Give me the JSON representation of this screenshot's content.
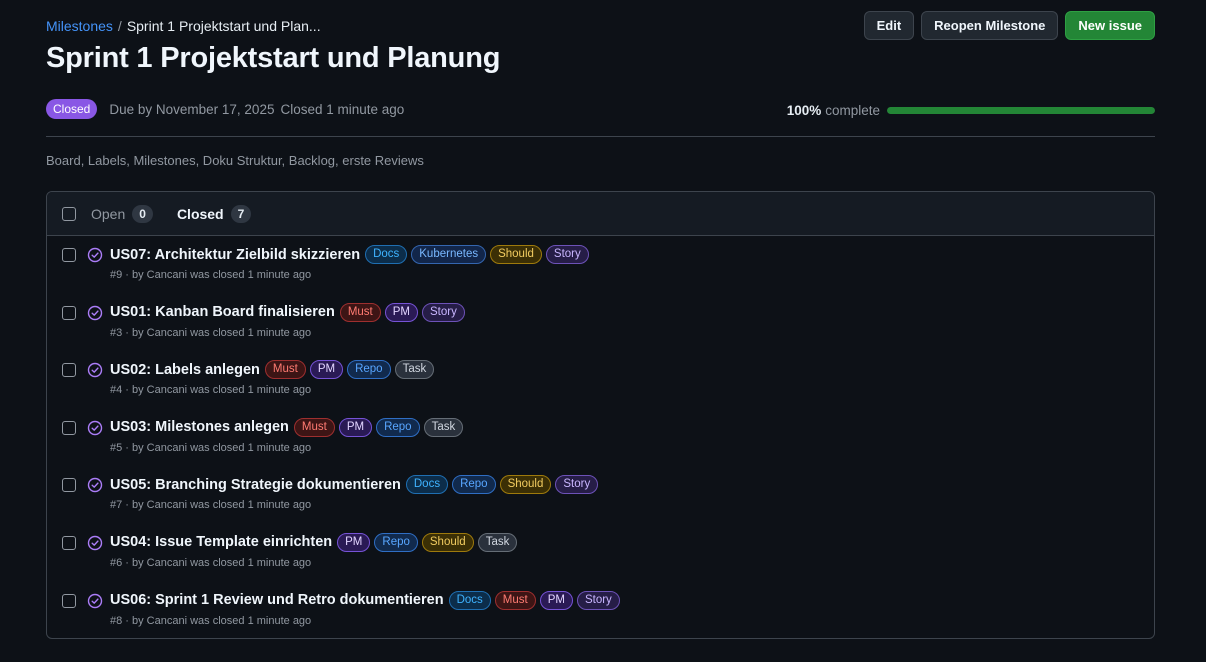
{
  "breadcrumb": {
    "parent": "Milestones",
    "separator": "/",
    "current": "Sprint 1 Projektstart und Plan..."
  },
  "actions": {
    "edit": "Edit",
    "reopen": "Reopen Milestone",
    "new_issue": "New issue"
  },
  "title": "Sprint 1 Projektstart und Planung",
  "meta": {
    "status": "Closed",
    "due": "Due by November 17, 2025",
    "closed": "Closed 1 minute ago"
  },
  "progress": {
    "percent_label": "100%",
    "suffix": "complete",
    "fraction": 1.0
  },
  "description": "Board, Labels, Milestones, Doku Struktur, Backlog, erste Reviews",
  "tabs": {
    "open_label": "Open",
    "open_count": "0",
    "closed_label": "Closed",
    "closed_count": "7"
  },
  "colors": {
    "accent_link": "#4493f8",
    "closed_purple": "#8957e5",
    "success_green": "#238636"
  },
  "issues": [
    {
      "title": "US07: Architektur Zielbild skizzieren",
      "meta": "#9 · by Cancani was closed 1 minute ago",
      "labels": [
        {
          "text": "Docs",
          "cls": "l-docs"
        },
        {
          "text": "Kubernetes",
          "cls": "l-kubernetes"
        },
        {
          "text": "Should",
          "cls": "l-should"
        },
        {
          "text": "Story",
          "cls": "l-story"
        }
      ]
    },
    {
      "title": "US01: Kanban Board finalisieren",
      "meta": "#3 · by Cancani was closed 1 minute ago",
      "labels": [
        {
          "text": "Must",
          "cls": "l-must"
        },
        {
          "text": "PM",
          "cls": "l-pm"
        },
        {
          "text": "Story",
          "cls": "l-story"
        }
      ]
    },
    {
      "title": "US02: Labels anlegen",
      "meta": "#4 · by Cancani was closed 1 minute ago",
      "labels": [
        {
          "text": "Must",
          "cls": "l-must"
        },
        {
          "text": "PM",
          "cls": "l-pm"
        },
        {
          "text": "Repo",
          "cls": "l-repo"
        },
        {
          "text": "Task",
          "cls": "l-task"
        }
      ]
    },
    {
      "title": "US03: Milestones anlegen",
      "meta": "#5 · by Cancani was closed 1 minute ago",
      "labels": [
        {
          "text": "Must",
          "cls": "l-must"
        },
        {
          "text": "PM",
          "cls": "l-pm"
        },
        {
          "text": "Repo",
          "cls": "l-repo"
        },
        {
          "text": "Task",
          "cls": "l-task"
        }
      ]
    },
    {
      "title": "US05: Branching Strategie dokumentieren",
      "meta": "#7 · by Cancani was closed 1 minute ago",
      "labels": [
        {
          "text": "Docs",
          "cls": "l-docs"
        },
        {
          "text": "Repo",
          "cls": "l-repo"
        },
        {
          "text": "Should",
          "cls": "l-should"
        },
        {
          "text": "Story",
          "cls": "l-story"
        }
      ]
    },
    {
      "title": "US04: Issue Template einrichten",
      "meta": "#6 · by Cancani was closed 1 minute ago",
      "labels": [
        {
          "text": "PM",
          "cls": "l-pm"
        },
        {
          "text": "Repo",
          "cls": "l-repo"
        },
        {
          "text": "Should",
          "cls": "l-should"
        },
        {
          "text": "Task",
          "cls": "l-task"
        }
      ]
    },
    {
      "title": "US06: Sprint 1 Review und Retro dokumentieren",
      "meta": "#8 · by Cancani was closed 1 minute ago",
      "labels": [
        {
          "text": "Docs",
          "cls": "l-docs"
        },
        {
          "text": "Must",
          "cls": "l-must"
        },
        {
          "text": "PM",
          "cls": "l-pm"
        },
        {
          "text": "Story",
          "cls": "l-story"
        }
      ]
    }
  ]
}
